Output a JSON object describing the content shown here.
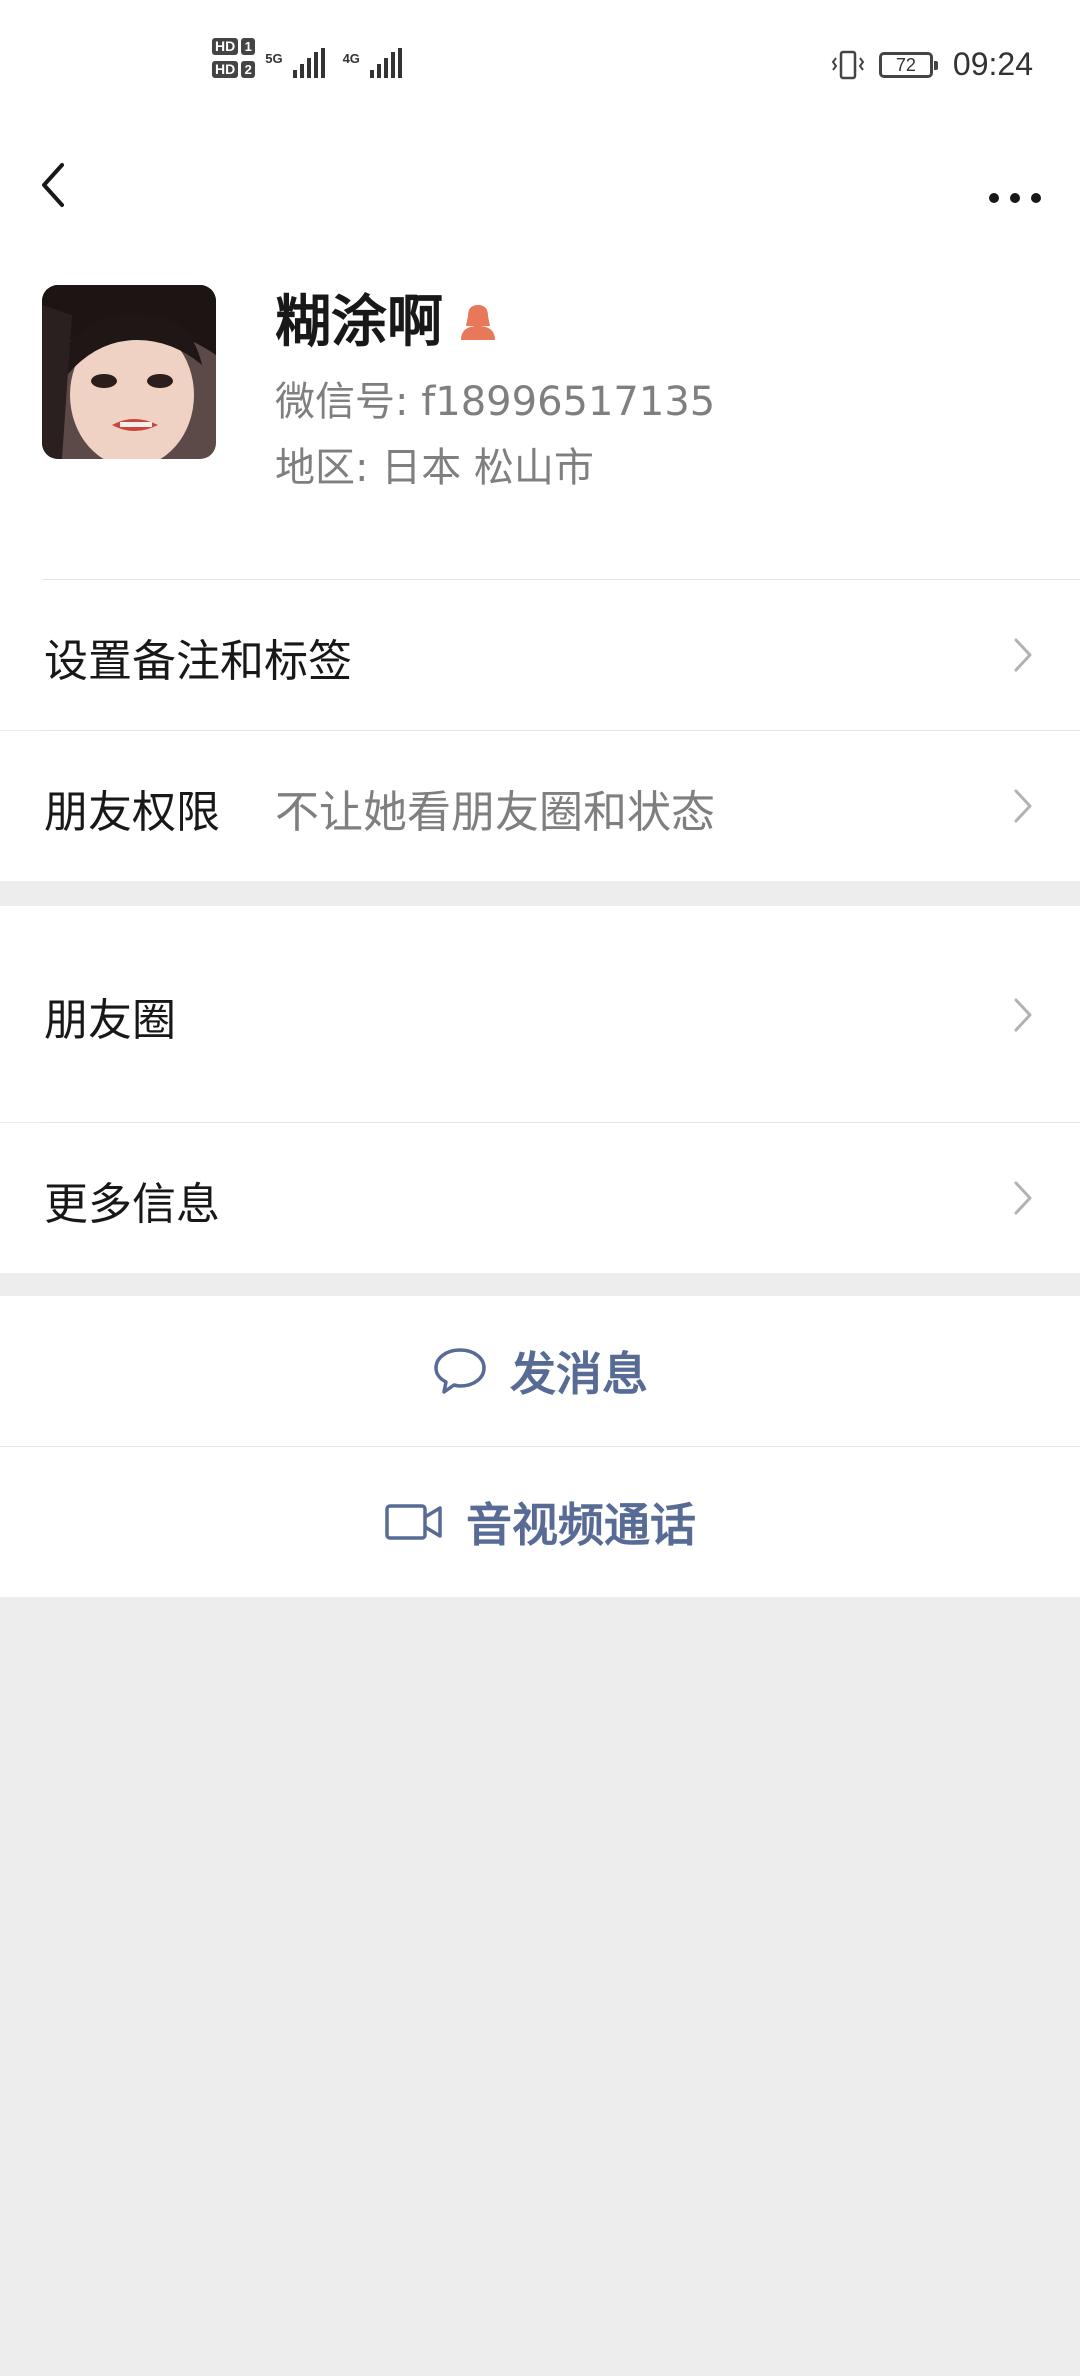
{
  "status_bar": {
    "sim1": "HD",
    "sim1_slot": "1",
    "sim2": "HD",
    "sim2_slot": "2",
    "network_1": "5G",
    "network_2": "4G",
    "battery": "72",
    "time": "09:24"
  },
  "nav": {
    "back_icon": "chevron-left-icon",
    "more_icon": "more-dots-icon"
  },
  "profile": {
    "name": "糊涂啊",
    "gender_icon": "female-icon",
    "wechat_id": "微信号:  f18996517135",
    "region": "地区:  日本  松山市"
  },
  "rows": {
    "remark_label": "设置备注和标签",
    "permission_label": "朋友权限",
    "permission_value": "不让她看朋友圈和状态",
    "moments_label": "朋友圈",
    "more_info_label": "更多信息"
  },
  "actions": {
    "message_label": "发消息",
    "video_call_label": "音视频通话"
  },
  "colors": {
    "link_blue": "#576b95",
    "female_orange": "#e8785a",
    "background_gray": "#ededed"
  }
}
